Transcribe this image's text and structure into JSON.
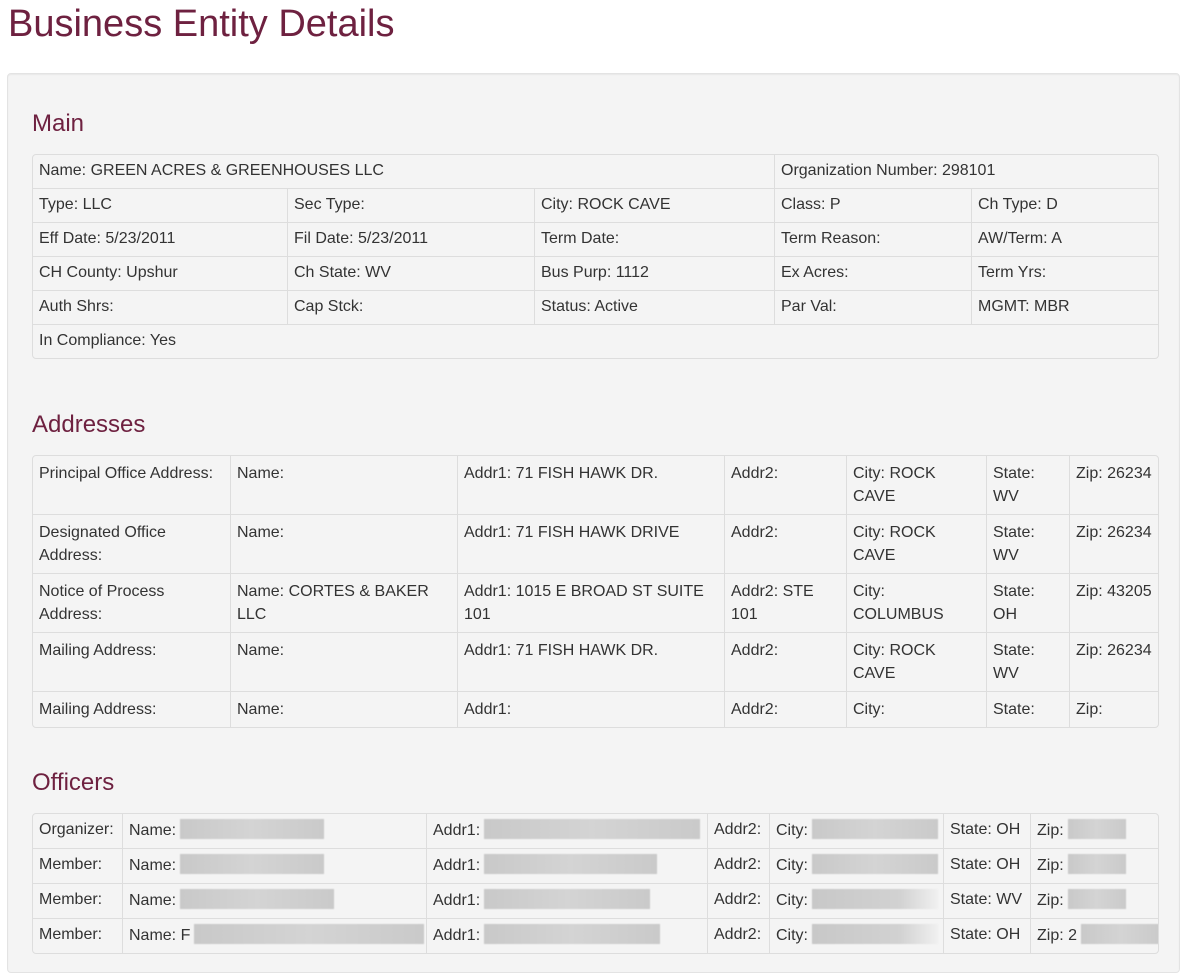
{
  "page_title": "Business Entity Details",
  "main": {
    "title": "Main",
    "rows": [
      [
        "Name: GREEN ACRES & GREENHOUSES LLC",
        "Organization Number: 298101"
      ],
      [
        "Type: LLC",
        "Sec Type:",
        "City: ROCK CAVE",
        "Class: P",
        "Ch Type: D"
      ],
      [
        "Eff Date: 5/23/2011",
        "Fil Date: 5/23/2011",
        "Term Date:",
        "Term Reason:",
        "AW/Term: A"
      ],
      [
        "CH County: Upshur",
        "Ch State: WV",
        "Bus Purp: 1112",
        "Ex Acres:",
        "Term Yrs:"
      ],
      [
        "Auth Shrs:",
        "Cap Stck:",
        "Status: Active",
        "Par Val:",
        "MGMT: MBR"
      ],
      [
        "In Compliance: Yes"
      ]
    ]
  },
  "addresses": {
    "title": "Addresses",
    "rows": [
      [
        "Principal Office Address:",
        "Name:",
        "Addr1: 71 FISH HAWK DR.",
        "Addr2:",
        "City: ROCK CAVE",
        "State: WV",
        "Zip: 26234"
      ],
      [
        "Designated Office Address:",
        "Name:",
        "Addr1: 71 FISH HAWK DRIVE",
        "Addr2:",
        "City: ROCK CAVE",
        "State: WV",
        "Zip: 26234"
      ],
      [
        "Notice of Process Address:",
        "Name: CORTES & BAKER LLC",
        "Addr1: 1015 E BROAD ST SUITE 101",
        "Addr2: STE 101",
        "City: COLUMBUS",
        "State: OH",
        "Zip: 43205"
      ],
      [
        "Mailing Address:",
        "Name:",
        "Addr1: 71 FISH HAWK DR.",
        "Addr2:",
        "City: ROCK CAVE",
        "State: WV",
        "Zip: 26234"
      ],
      [
        "Mailing Address:",
        "Name:",
        "Addr1:",
        "Addr2:",
        "City:",
        "State:",
        "Zip:"
      ]
    ]
  },
  "officers": {
    "title": "Officers",
    "rows": [
      {
        "role": "Organizer:",
        "name": "Name:",
        "addr1": "Addr1:",
        "addr2": "Addr2:",
        "city": "City:",
        "state": "State: OH",
        "zip": "Zip:"
      },
      {
        "role": "Member:",
        "name": "Name:",
        "addr1": "Addr1:",
        "addr2": "Addr2:",
        "city": "City:",
        "state": "State: OH",
        "zip": "Zip:"
      },
      {
        "role": "Member:",
        "name": "Name:",
        "addr1": "Addr1:",
        "addr2": "Addr2:",
        "city": "City:",
        "state": "State: WV",
        "zip": "Zip:"
      },
      {
        "role": "Member:",
        "name": "Name: F",
        "addr1": "Addr1:",
        "addr2": "Addr2:",
        "city": "City:",
        "state": "State: OH",
        "zip": "Zip: 2"
      }
    ]
  }
}
